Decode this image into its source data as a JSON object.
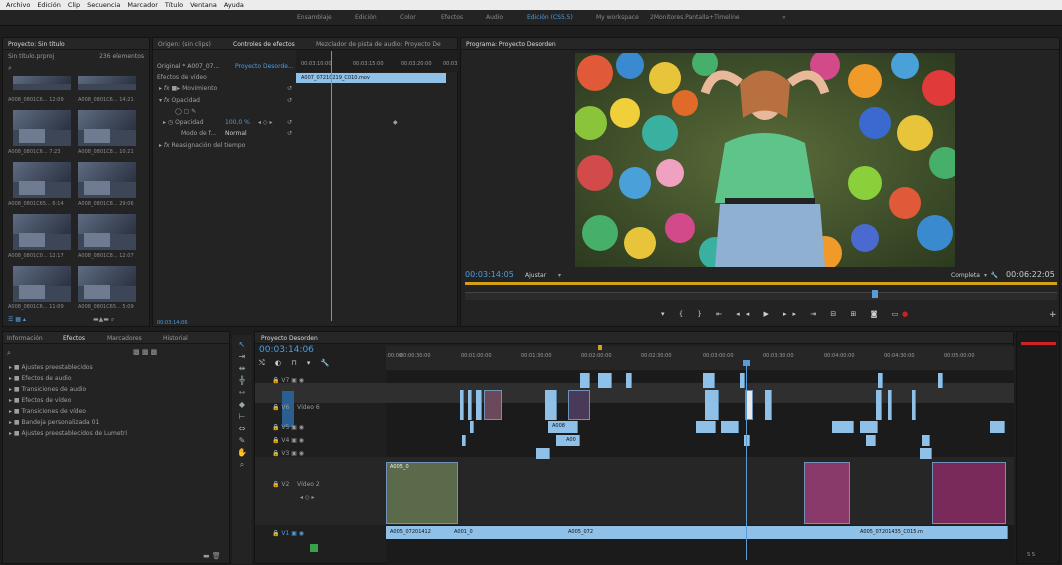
{
  "menu": [
    "Archivo",
    "Edición",
    "Clip",
    "Secuencia",
    "Marcador",
    "Título",
    "Ventana",
    "Ayuda"
  ],
  "workspaces": [
    "Ensamblaje",
    "Edición",
    "Color",
    "Efectos",
    "Audio",
    "Edición (CS5.5)",
    "My workspace",
    "2Monitores.Pantalla+Timeline",
    "»"
  ],
  "workspace_active": "Edición (CS5.5)",
  "project": {
    "tab": "Proyecto: Sin título",
    "file": "Sin título.prproj",
    "count": "236 elementos",
    "thumbs": [
      {
        "label": "A008_0801C6... 12:09"
      },
      {
        "label": "A008_0801C6... 14:21"
      },
      {
        "label": "A008_0801C6... 7:23"
      },
      {
        "label": "A008_0801C8... 10:21"
      },
      {
        "label": "A008_0801C65... 6:14"
      },
      {
        "label": "A008_0801C8... 29:06"
      },
      {
        "label": "A008_0801C0... 12:17"
      },
      {
        "label": "A008_0801C8... 12:07"
      },
      {
        "label": "A008_0801C6... 11:09"
      },
      {
        "label": "A008_0801C65... 5:09"
      }
    ]
  },
  "effectControls": {
    "tabs": [
      "Origen: (sin clips)",
      "Controles de efectos",
      "Mezclador de pista de audio: Proyecto De"
    ],
    "source": "Original * A007_07...",
    "seq": "Proyecto Desorde...",
    "ruler": [
      "00:03:10:00",
      "00:03:15:00",
      "00:03:20:00",
      "00:03"
    ],
    "clip": "A007_07210219_C010.mov",
    "section": "Efectos de vídeo",
    "rows": [
      "Movimiento",
      "Opacidad",
      "Opacidad",
      "Modo de f...",
      "Reasignación del tiempo"
    ],
    "opacity_value": "100,0 %",
    "blend_value": "Normal",
    "timecode": "00:03:14:06"
  },
  "program": {
    "tab": "Programa: Proyecto Desorden",
    "timecode": "00:03:14:05",
    "fit": "Ajustar",
    "quality": "Completa",
    "duration": "00:06:22:05"
  },
  "effects": {
    "tabs": [
      "Información",
      "Efectos",
      "Marcadores",
      "Historial"
    ],
    "items": [
      "Ajustes preestablecidos",
      "Efectos de audio",
      "Transiciones de audio",
      "Efectos de vídeo",
      "Transiciones de vídeo",
      "Bandeja personalizada 01",
      "Ajustes preestablecidos de Lumetri"
    ]
  },
  "timeline": {
    "tab": "Proyecto Desorden",
    "timecode": "00:03:14:06",
    "ruler": [
      ":00:00",
      "00:00:30:00",
      "00:01:00:00",
      "00:01:30:00",
      "00:02:00:00",
      "00:02:30:00",
      "00:03:00:00",
      "00:03:30:00",
      "00:04:00:00",
      "00:04:30:00",
      "00:05:00:00"
    ],
    "tracks": [
      {
        "id": "V7",
        "name": ""
      },
      {
        "id": "V6",
        "name": "Vídeo 6"
      },
      {
        "id": "V5",
        "name": ""
      },
      {
        "id": "V4",
        "name": ""
      },
      {
        "id": "V3",
        "name": ""
      },
      {
        "id": "V2",
        "name": "Vídeo 2"
      },
      {
        "id": "V1",
        "name": ""
      }
    ],
    "clip_labels": [
      "A005_07201412",
      "A001_0",
      "A005_072",
      "A005_07201435_C015.m",
      "A005_0",
      "A008",
      "A00"
    ],
    "keyframe_nav": "◂ ◇ ▸",
    "vu_label": "S  S"
  },
  "colors": {
    "accent": "#5aa9e6",
    "playhead": "#5b9bd5",
    "clip": "#8fc1e8",
    "rec": "#cc2222"
  }
}
